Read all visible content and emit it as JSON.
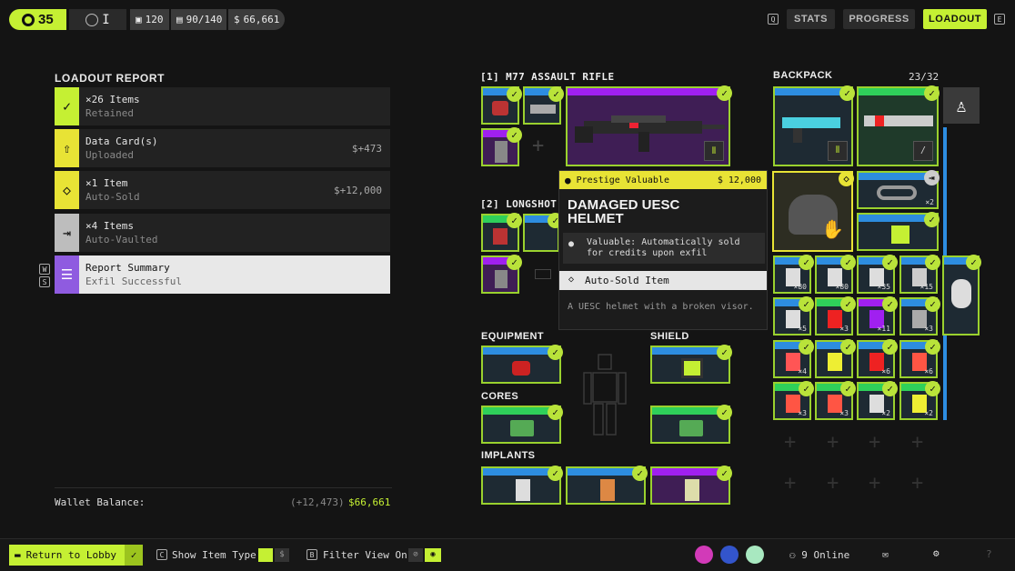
{
  "topbar": {
    "level": "35",
    "rank": "I",
    "stat1": "120",
    "stat2": "90/140",
    "credits": "66,661",
    "key_q": "Q",
    "key_e": "E",
    "nav": [
      "STATS",
      "PROGRESS",
      "LOADOUT"
    ]
  },
  "report": {
    "title": "LOADOUT REPORT",
    "rows": [
      {
        "t1": "×26 Items",
        "t2": "Retained",
        "val": "",
        "icon": "check-icon"
      },
      {
        "t1": "Data Card(s)",
        "t2": "Uploaded",
        "val": "+473",
        "icon": "upload-icon"
      },
      {
        "t1": "×1 Item",
        "t2": "Auto-Sold",
        "val": "+12,000",
        "icon": "sold-icon"
      },
      {
        "t1": "×4 Items",
        "t2": "Auto-Vaulted",
        "val": "",
        "icon": "vault-icon"
      },
      {
        "t1": "Report Summary",
        "t2": "Exfil Successful",
        "val": "",
        "icon": "list-icon"
      }
    ],
    "key_w": "W",
    "key_s": "S",
    "wallet_label": "Wallet Balance:",
    "wallet_delta": "(+12,473)",
    "wallet_total": "66,661"
  },
  "weapons": {
    "primary": "[1] M77 ASSAULT RIFLE",
    "secondary": "[2] LONGSHOT"
  },
  "sections": {
    "equipment": "EQUIPMENT",
    "shield": "SHIELD",
    "cores": "CORES",
    "implants": "IMPLANTS"
  },
  "backpack": {
    "title": "BACKPACK",
    "capacity": "23/32",
    "counts": [
      "×80",
      "×80",
      "×35",
      "×15",
      "×5",
      "×3",
      "×11",
      "×3",
      "×4",
      "",
      "×6",
      "×6",
      "×3",
      "×3",
      "×2",
      "×2"
    ],
    "count_x2": "×2"
  },
  "tooltip": {
    "tag": "Prestige Valuable",
    "price": "12,000",
    "name": "DAMAGED UESC HELMET",
    "valuable": "Valuable: Automatically sold for credits upon exfil",
    "autosold": "Auto-Sold Item",
    "desc": "A UESC helmet with a broken visor."
  },
  "bottom": {
    "return": "Return to Lobby",
    "showtype": "Show Item Type",
    "filter": "Filter View On",
    "online": "9 Online",
    "key_c": "C",
    "key_b": "B"
  },
  "colors": {
    "accent": "#c5f033",
    "purple": "#a020f0",
    "blue": "#2d8de0",
    "green": "#2fd05a",
    "yellow": "#e8e335"
  }
}
